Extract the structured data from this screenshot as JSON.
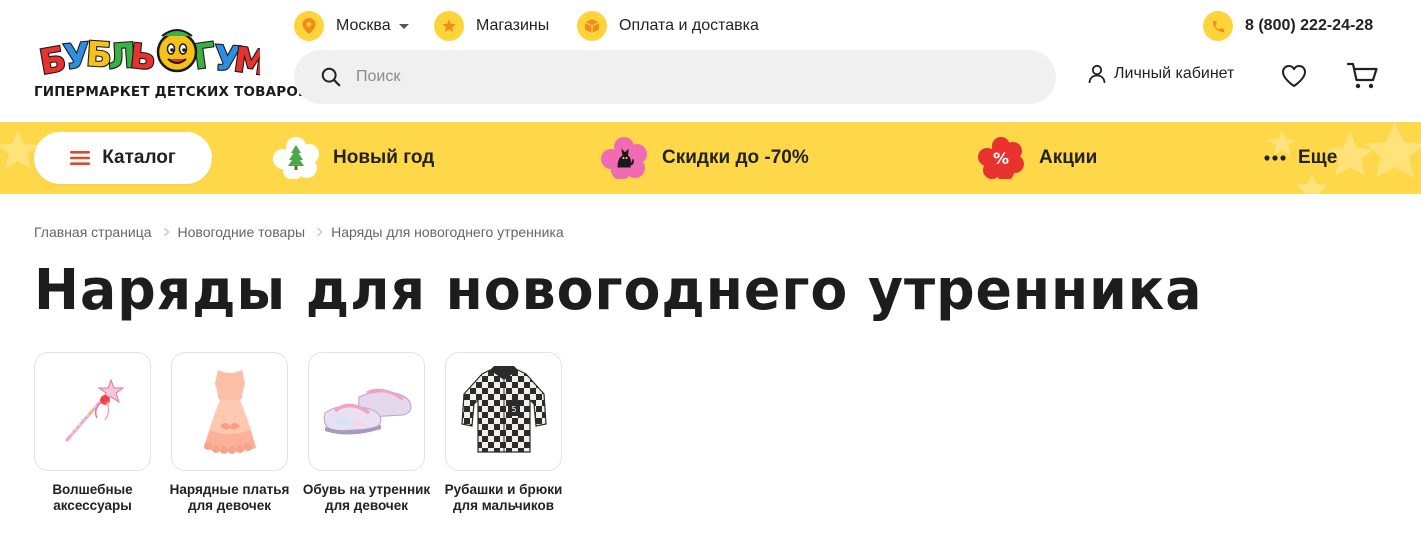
{
  "header": {
    "logo_text": "БУБЛЬ ГУМ",
    "logo_subtitle": "ГИПЕРМАРКЕТ ДЕТСКИХ ТОВАРОВ",
    "city": "Москва",
    "stores": "Магазины",
    "delivery": "Оплата и доставка",
    "phone": "8 (800) 222-24-28",
    "search_placeholder": "Поиск",
    "account": "Личный кабинет",
    "accent": "#ffd43b",
    "icons": {
      "city": "location-pin-icon",
      "stores": "star-icon",
      "delivery": "box-icon",
      "phone": "phone-icon",
      "search": "search-icon",
      "account": "user-icon",
      "favorites": "heart-icon",
      "cart": "cart-icon"
    }
  },
  "nav": {
    "background": "#ffd84a",
    "catalog": "Каталог",
    "items": [
      {
        "label": "Новый год",
        "icon": "christmas-tree-icon"
      },
      {
        "label": "Скидки до -70%",
        "icon": "cat-flower-icon"
      },
      {
        "label": "Акции",
        "icon": "percent-badge-icon"
      },
      {
        "label": "Еще",
        "icon": "more-dots-icon"
      }
    ]
  },
  "breadcrumbs": [
    "Главная страница",
    "Новогодние товары",
    "Наряды для новогоднего утренника"
  ],
  "page_title": "Наряды для новогоднего утренника",
  "subcategories": [
    {
      "name": "Волшебные аксессуары",
      "image": "magic-wand-image"
    },
    {
      "name": "Нарядные платья для девочек",
      "image": "peach-dress-image"
    },
    {
      "name": "Обувь на утренник для девочек",
      "image": "party-shoes-image"
    },
    {
      "name": "Рубашки и брюки для мальчиков",
      "image": "plaid-shirt-image"
    }
  ]
}
